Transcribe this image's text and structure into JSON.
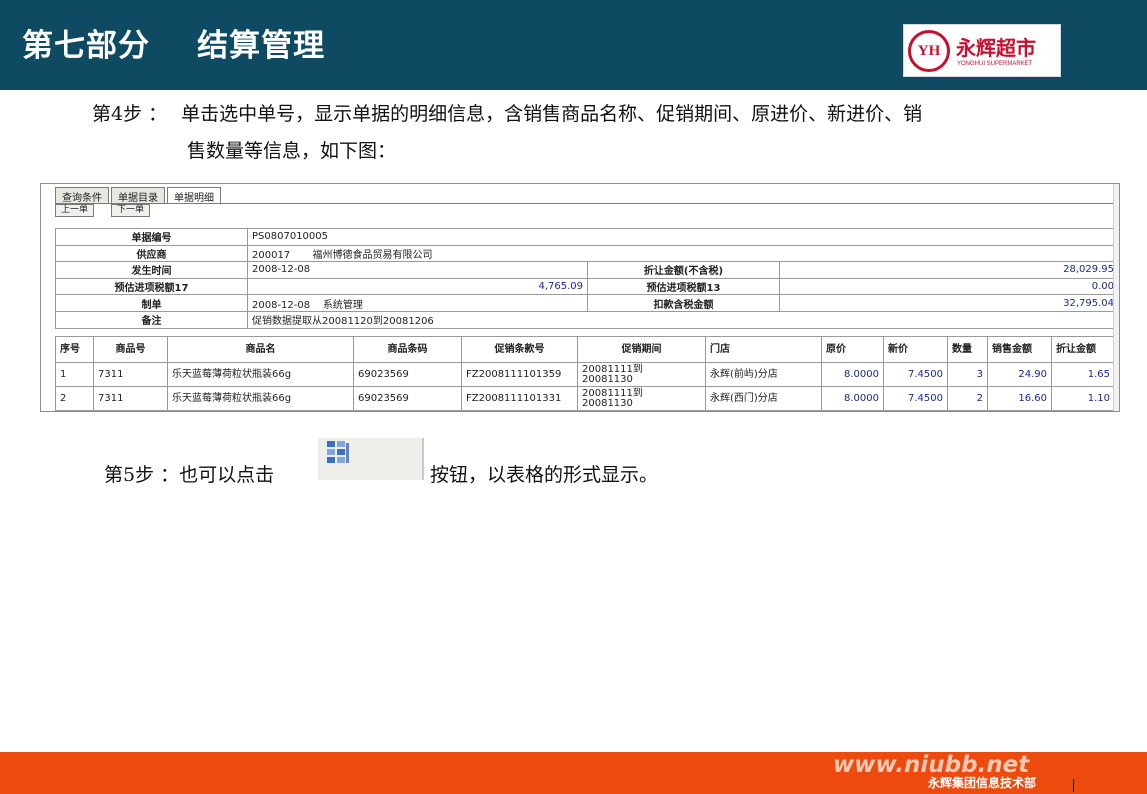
{
  "header": {
    "title": "第七部分    结算管理",
    "logo": {
      "emblem": "YH",
      "name_cn": "永辉超市",
      "name_en": "YONGHUI SUPERMARKET",
      "color": "#c8102e"
    },
    "bg_color": "#0f4a63"
  },
  "step4": {
    "label": "第4步  ：",
    "line1": "单击选中单号，显示单据的明细信息，含销售商品名称、促销期间、原进价、新进价、销",
    "line2": "售数量等信息，如下图："
  },
  "window": {
    "tabs": [
      "查询条件",
      "单据目录",
      "单据明细"
    ],
    "active_tab": "单据明细",
    "nav": {
      "prev": "上一单",
      "next": "下一单"
    },
    "info": {
      "doc_no_label": "单据编号",
      "doc_no": "PS0807010005",
      "supplier_label": "供应商",
      "supplier_code": "200017",
      "supplier_name": "福州博德食品贸易有限公司",
      "time_label": "发生时间",
      "time": "2008-12-08",
      "discount_label": "折让金额(不含税)",
      "discount": "28,029.95",
      "tax17_label": "预估进项税额17",
      "tax17": "4,765.09",
      "tax13_label": "预估进项税额13",
      "tax13": "0.00",
      "maker_label": "制单",
      "make_date": "2008-12-08",
      "maker": "系统管理",
      "deduct_label": "扣款含税金额",
      "deduct": "32,795.04",
      "remark_label": "备注",
      "remark": "促销数据提取从20081120到20081206"
    },
    "detail": {
      "columns": [
        "序号",
        "商品号",
        "商品名",
        "商品条码",
        "促销条款号",
        "促销期间",
        "门店",
        "原价",
        "新价",
        "数量",
        "销售金额",
        "折让金额"
      ],
      "rows": [
        {
          "seq": "1",
          "sku": "7311",
          "name": "乐天蓝莓薄荷粒状瓶装66g",
          "barcode": "69023569",
          "promo_no": "FZ2008111101359",
          "period_a": "20081111到",
          "period_b": "20081130",
          "store": "永辉(前屿)分店",
          "old_price": "8.0000",
          "new_price": "7.4500",
          "qty": "3",
          "sales": "24.90",
          "discount": "1.65"
        },
        {
          "seq": "2",
          "sku": "7311",
          "name": "乐天蓝莓薄荷粒状瓶装66g",
          "barcode": "69023569",
          "promo_no": "FZ2008111101331",
          "period_a": "20081111到",
          "period_b": "20081130",
          "store": "永辉(西门)分店",
          "old_price": "8.0000",
          "new_price": "7.4500",
          "qty": "2",
          "sales": "16.60",
          "discount": "1.10"
        }
      ]
    }
  },
  "step5": {
    "label": "第5步  ：",
    "pre": "也可以点击",
    "post": "按钮，以表格的形式显示。",
    "button_icon": "grid-view-icon"
  },
  "footer": {
    "watermark": "www.niubb.net",
    "dept": "永辉集团信息技术部",
    "bg_color": "#ec4b0d"
  }
}
